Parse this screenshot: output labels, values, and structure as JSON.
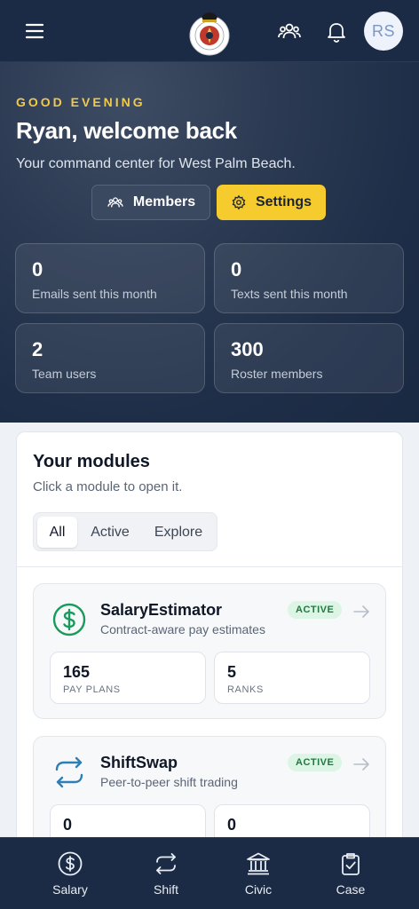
{
  "header": {
    "menu_icon": "hamburger-menu-icon",
    "logo": "union-seal-logo",
    "team_icon": "users-icon",
    "notifications_icon": "bell-icon",
    "avatar_initials": "RS"
  },
  "hero": {
    "greeting": "GOOD EVENING",
    "welcome": "Ryan, welcome back",
    "subtitle": "Your command center for West Palm Beach.",
    "members_button": "Members",
    "settings_button": "Settings",
    "stats": [
      {
        "value": "0",
        "label": "Emails sent this month"
      },
      {
        "value": "0",
        "label": "Texts sent this month"
      },
      {
        "value": "2",
        "label": "Team users"
      },
      {
        "value": "300",
        "label": "Roster members"
      }
    ]
  },
  "modules": {
    "title": "Your modules",
    "subtitle": "Click a module to open it.",
    "filters": [
      "All",
      "Active",
      "Explore"
    ],
    "selected_filter": "All",
    "items": [
      {
        "name": "SalaryEstimator",
        "description": "Contract-aware pay estimates",
        "badge": "ACTIVE",
        "icon": "dollar-circle-icon",
        "stats": [
          {
            "value": "165",
            "label": "PAY PLANS"
          },
          {
            "value": "5",
            "label": "RANKS"
          }
        ]
      },
      {
        "name": "ShiftSwap",
        "description": "Peer-to-peer shift trading",
        "badge": "ACTIVE",
        "icon": "swap-arrows-icon",
        "stats": [
          {
            "value": "0",
            "label": ""
          },
          {
            "value": "0",
            "label": ""
          }
        ]
      }
    ]
  },
  "bottom_nav": [
    {
      "label": "Salary",
      "icon": "dollar-circle-icon"
    },
    {
      "label": "Shift",
      "icon": "swap-arrows-icon"
    },
    {
      "label": "Civic",
      "icon": "civic-building-icon"
    },
    {
      "label": "Case",
      "icon": "clipboard-check-icon"
    }
  ],
  "colors": {
    "header_bg": "#1c2b45",
    "accent_yellow": "#f5cb2e",
    "active_badge_bg": "#dcf5e4",
    "active_badge_text": "#1d7a40",
    "salary_icon": "#1a9a5c",
    "shift_icon": "#2f7fb5"
  }
}
